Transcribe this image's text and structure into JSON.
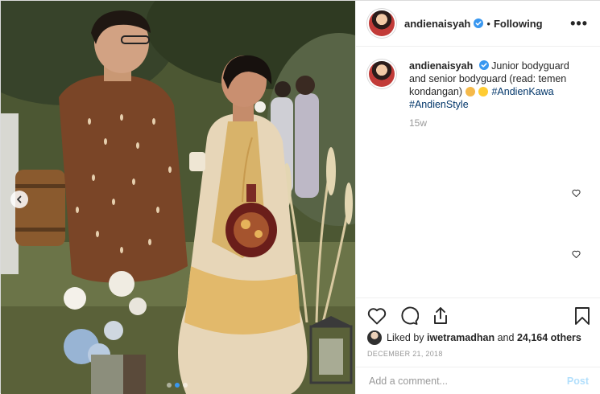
{
  "post": {
    "username": "andienaisyah",
    "follow_separator": "•",
    "follow_status": "Following",
    "more_label": "•••"
  },
  "caption": {
    "username": "andienaisyah",
    "text": "Junior bodyguard and senior bodyguard (read: temen kondangan)",
    "hashtags": [
      "#AndienKawa",
      "#AndienStyle"
    ],
    "age": "15w"
  },
  "likes": {
    "liked_by_prefix": "Liked by",
    "liked_by_user": "iwetramadhan",
    "and_label": "and",
    "others": "24,164 others"
  },
  "date": "DECEMBER 21, 2018",
  "comment_box": {
    "placeholder": "Add a comment...",
    "post_label": "Post"
  },
  "colors": {
    "verified": "#3897f0",
    "hashtag": "#003569",
    "post_disabled": "#b2dffc",
    "meta_gray": "#999999"
  },
  "icons": [
    "verified-badge-icon",
    "chevron-left-icon",
    "heart-icon",
    "comment-icon",
    "share-icon",
    "bookmark-icon"
  ]
}
